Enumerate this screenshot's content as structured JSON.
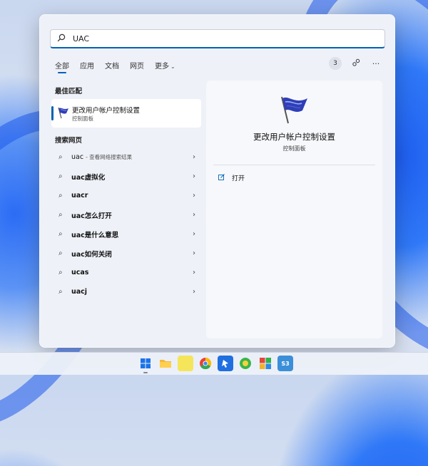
{
  "search": {
    "query": "UAC"
  },
  "tabs": [
    {
      "label": "全部"
    },
    {
      "label": "应用"
    },
    {
      "label": "文档"
    },
    {
      "label": "网页"
    },
    {
      "label": "更多"
    }
  ],
  "top_right": {
    "count": "3"
  },
  "sections": {
    "best_match": "最佳匹配",
    "search_web": "搜索网页"
  },
  "best_match": {
    "title": "更改用户帐户控制设置",
    "subtitle": "控制面板"
  },
  "web_results": [
    {
      "label": "uac",
      "hint": "- 查看网络搜索结果"
    },
    {
      "label": "uac虚拟化",
      "hint": ""
    },
    {
      "label": "uacr",
      "hint": ""
    },
    {
      "label": "uac怎么打开",
      "hint": ""
    },
    {
      "label": "uac是什么意思",
      "hint": ""
    },
    {
      "label": "uac如何关闭",
      "hint": ""
    },
    {
      "label": "ucas",
      "hint": ""
    },
    {
      "label": "uacj",
      "hint": ""
    }
  ],
  "preview": {
    "title": "更改用户帐户控制设置",
    "subtitle": "控制面板",
    "open_label": "打开"
  },
  "colors": {
    "accent": "#0063b1",
    "flag_blue": "#2f3fb8"
  },
  "taskbar": [
    "start-icon",
    "file-explorer-icon",
    "notes-icon",
    "browser-icon",
    "app-icon",
    "green-app-icon",
    "puzzle-app-icon",
    "s3-app-icon"
  ]
}
